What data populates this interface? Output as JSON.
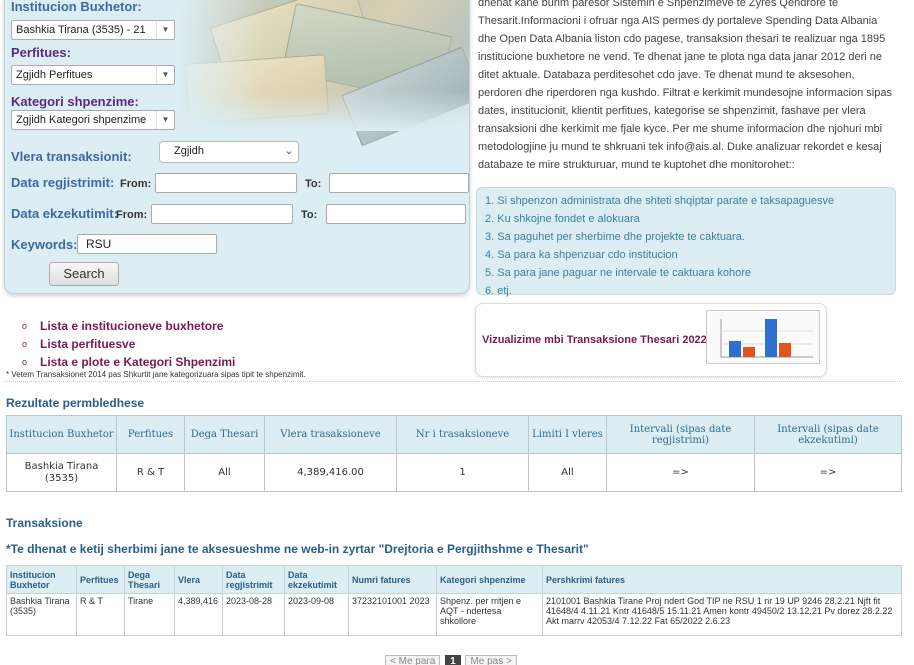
{
  "search": {
    "institucion_label": "Institucion Buxhetor:",
    "institucion_value": "Bashkia Tirana (3535) - 21",
    "perfitues_label": "Perfitues:",
    "perfitues_value": "Zgjidh Perfitues",
    "kategori_label": "Kategori shpenzime:",
    "kategori_value": "Zgjidh Kategori shpenzime",
    "vlera_label": "Vlera transaksionit:",
    "vlera_value": "Zgjidh",
    "regjistrimit_label": "Data regjistrimit:",
    "ekzekutimit_label": "Data ekzekutimit:",
    "from_label": "From:",
    "to_label": "To:",
    "keywords_label": "Keywords:",
    "keywords_value": "RSU",
    "search_button": "Search"
  },
  "description": "dhenat kane burim paresor Sistemin e Shpenzimeve te Zyres Qendrore te Thesarit.Informacioni i ofruar nga AIS permes dy portaleve Spending Data Albania dhe Open Data Albania liston cdo pagese, transaksion thesari te realizuar nga 1895 institucione buxhetore ne vend. Te dhenat jane te plota nga data janar 2012 deri ne ditet aktuale. Databaza perditesohet cdo jave. Te dhenat mund te aksesohen, perdoren dhe riperdoren nga kushdo. Filtrat e kerkimit mundesojne informacion sipas dates, institucionit, klientit perfitues, kategorise se shpenzimit, fashave per vlera transaksioni dhe kerkimit me fjale kyce. Per me shume informacion dhe njohuri mbi metodologjine ju mund te shkruani tek info@ais.al. Duke analizuar rekordet e kesaj databaze te mire strukturuar, mund te kuptohet dhe monitorohet::",
  "info_list": [
    "1. Si shpenzon administrata dhe shteti shqiptar parate e taksapaguesve",
    "2. Ku shkojne fondet e alokuara",
    "3. Sa paguhet per sherbime dhe projekte te caktuara.",
    "4. Sa para ka shpenzuar cdo institucion",
    "5. Sa para jane paguar ne intervale te caktuara kohore",
    "6. etj."
  ],
  "links": [
    "Lista e institucioneve buxhetore",
    "Lista perfituesve",
    "Lista e plote e Kategori Shpenzimi"
  ],
  "footnote": "* Vetem Transaksionet 2014 pas Shkurtit jane kategorizuara sipas tipit te shpenzimit.",
  "viz_title": "Vizualizime mbi Transaksione Thesari 2022",
  "summary": {
    "heading": "Rezultate permbledhese",
    "headers": [
      "Institucion Buxhetor",
      "Perfitues",
      "Dega Thesari",
      "Vlera trasaksioneve",
      "Nr i trasaksioneve",
      "Limiti I vleres",
      "Intervali (sipas date regjistrimi)",
      "Intervali (sipas date ekzekutimi)"
    ],
    "row": [
      "Bashkia Tirana (3535)",
      "R & T",
      "All",
      "4,389,416.00",
      "1",
      "All",
      "=>",
      "=>"
    ]
  },
  "transactions": {
    "heading": "Transaksione",
    "notice": "*Te dhenat e ketij sherbimi jane te aksesueshme ne web-in zyrtar \"Drejtoria e Pergjithshme e Thesarit\"",
    "headers": [
      "Institucion Buxhetor",
      "Perfitues",
      "Dega Thesari",
      "Vlera",
      "Data regjistrimit",
      "Data ekzekutimit",
      "Numri fatures",
      "Kategori shpenzime",
      "Pershkrimi fatures"
    ],
    "row": [
      "Bashkia Tirana (3535)",
      "R & T",
      "Tirane",
      "4,389,416",
      "2023-08-28",
      "2023-09-08",
      "37232101001 2023",
      "Shpenz. per rritjen e AQT - ndertesa shkollore",
      "2101001 Bashkia Tirane Proj ndert God TIP ne RSU 1 nr 19 UP 9246 28.2.21 Njft fit 41648/4 4.11.21 Kntr 41648/5 15.11.21 Amen kontr 49450/2 13.12.21 Pv dorez 28.2.22 Akt marrv 42053/4 7.12.22 Fat 65/2022 2.6.23"
    ]
  },
  "pager": {
    "prev": "< Me para",
    "current": "1",
    "next": "Me pas >"
  },
  "viz_chart": {
    "bar_colors": [
      "#2e6fd0",
      "#e2541c"
    ]
  }
}
